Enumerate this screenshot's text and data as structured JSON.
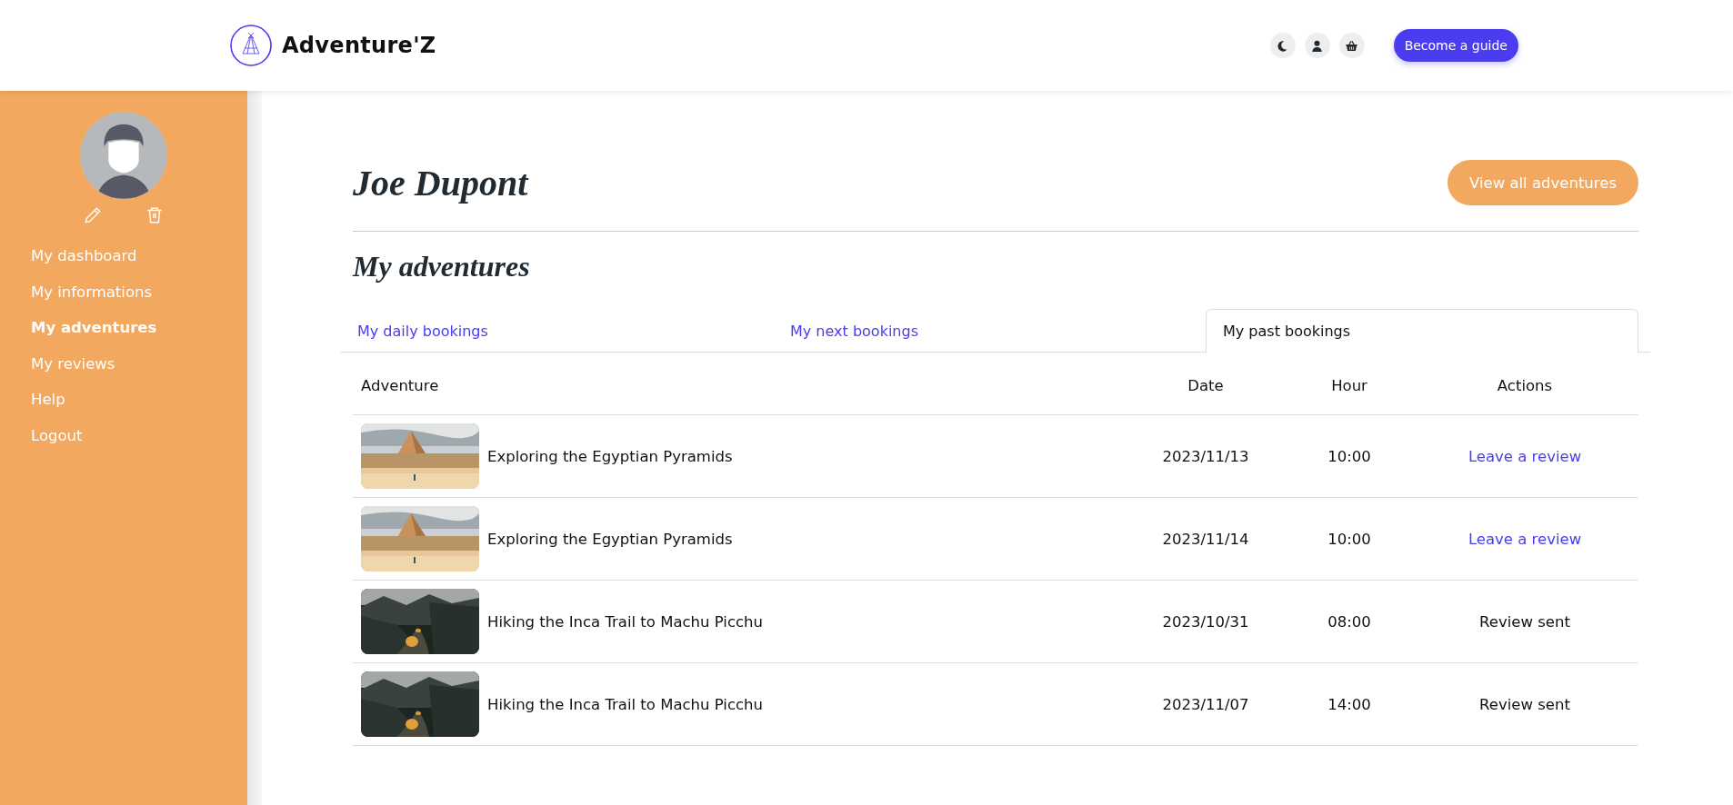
{
  "header": {
    "logo_text": "Adventure'Z",
    "cta": "Become a guide"
  },
  "sidebar": {
    "items": [
      {
        "label": "My dashboard",
        "selected": false
      },
      {
        "label": "My informations",
        "selected": false
      },
      {
        "label": "My adventures",
        "selected": true
      },
      {
        "label": "My reviews",
        "selected": false
      },
      {
        "label": "Help",
        "selected": false
      },
      {
        "label": "Logout",
        "selected": false
      }
    ]
  },
  "main": {
    "title": "Joe Dupont",
    "view_all_button": "View all adventures",
    "section_title": "My adventures",
    "tabs": [
      {
        "label": "My daily bookings",
        "selected": false
      },
      {
        "label": "My next bookings",
        "selected": false
      },
      {
        "label": "My past bookings",
        "selected": true
      }
    ],
    "table": {
      "columns": [
        "Adventure",
        "Date",
        "Hour",
        "Actions"
      ],
      "rows": [
        {
          "adventure": "Exploring the Egyptian Pyramids",
          "date": "2023/11/13",
          "hour": "10:00",
          "action": {
            "kind": "link",
            "text": "Leave a review"
          }
        },
        {
          "adventure": "Exploring the Egyptian Pyramids",
          "date": "2023/11/14",
          "hour": "10:00",
          "action": {
            "kind": "link",
            "text": "Leave a review"
          }
        },
        {
          "adventure": "Hiking the Inca Trail to Machu Picchu",
          "date": "2023/10/31",
          "hour": "08:00",
          "action": {
            "kind": "status",
            "text": "Review sent"
          }
        },
        {
          "adventure": "Hiking the Inca Trail to Machu Picchu",
          "date": "2023/11/07",
          "hour": "14:00",
          "action": {
            "kind": "status",
            "text": "Review sent"
          }
        }
      ]
    }
  }
}
